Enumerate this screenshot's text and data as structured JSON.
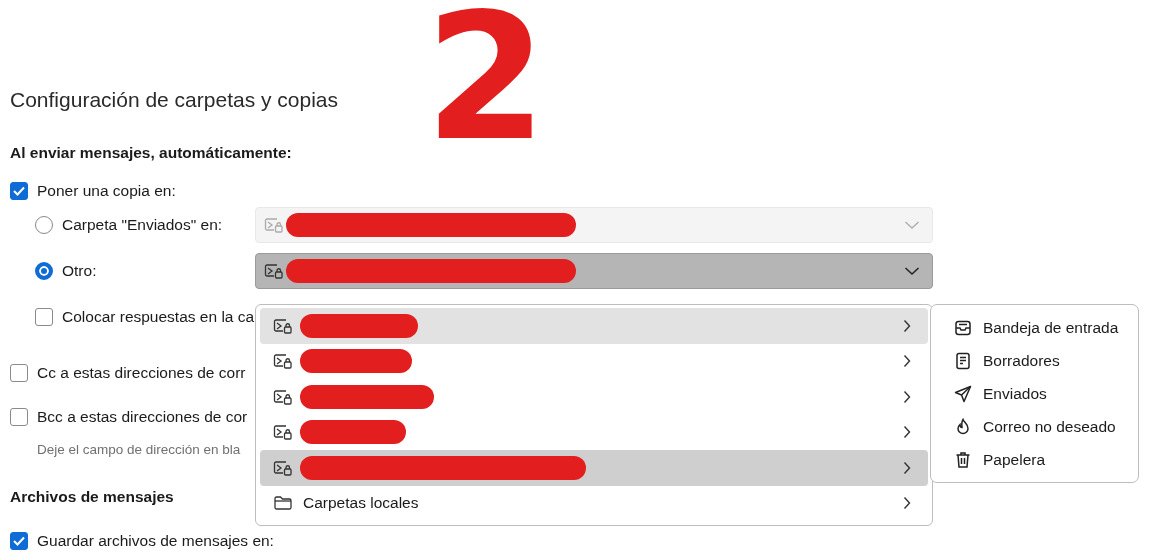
{
  "annotation": "2",
  "title": "Configuración de carpetas y copias",
  "sending": {
    "heading": "Al enviar mensajes, automáticamente:",
    "copy": {
      "label": "Poner una copia en:",
      "checked": true
    },
    "options": [
      {
        "kind": "radio",
        "label": "Carpeta \"Enviados\" en:",
        "selected": false,
        "select": {
          "disabled": true,
          "redacted": true
        }
      },
      {
        "kind": "radio",
        "label": "Otro:",
        "selected": true,
        "select": {
          "disabled": false,
          "redacted": true
        }
      },
      {
        "kind": "checkbox",
        "label": "Colocar respuestas en la ca",
        "checked": false
      }
    ],
    "extra": [
      {
        "kind": "checkbox",
        "label": "Cc a estas direcciones de corr",
        "checked": false
      },
      {
        "kind": "checkbox",
        "label": "Bcc a estas direcciones de cor",
        "checked": false
      },
      {
        "kind": "hint",
        "label": "Deje el campo de dirección en bla"
      }
    ]
  },
  "archives": {
    "heading": "Archivos de mensajes",
    "save": {
      "label": "Guardar archivos de mensajes en:",
      "checked": true
    }
  },
  "dropdown": {
    "items": [
      {
        "kind": "account",
        "redacted": true,
        "highlighted": true,
        "expanded": false
      },
      {
        "kind": "account",
        "redacted": true,
        "highlighted": false,
        "expanded": false
      },
      {
        "kind": "account",
        "redacted": true,
        "highlighted": false,
        "expanded": false
      },
      {
        "kind": "account",
        "redacted": true,
        "highlighted": false,
        "expanded": false
      },
      {
        "kind": "account",
        "redacted": true,
        "highlighted": false,
        "expanded": true
      },
      {
        "kind": "local",
        "label": "Carpetas locales",
        "highlighted": false,
        "expanded": false
      }
    ]
  },
  "submenu": {
    "items": [
      {
        "kind": "inbox",
        "label": "Bandeja de entrada"
      },
      {
        "kind": "drafts",
        "label": "Borradores"
      },
      {
        "kind": "sent",
        "label": "Enviados"
      },
      {
        "kind": "junk",
        "label": "Correo no deseado"
      },
      {
        "kind": "trash",
        "label": "Papelera"
      }
    ]
  }
}
